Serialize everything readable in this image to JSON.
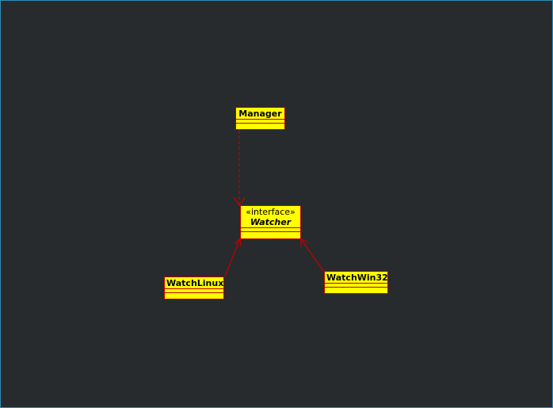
{
  "diagram": {
    "type": "uml-class-diagram",
    "colors": {
      "background": "#272b2e",
      "class_fill": "#ffff00",
      "class_border": "#c00000",
      "edge": "#c00000",
      "frame_border": "#2f8fb8"
    },
    "classes": {
      "manager": {
        "name": "Manager"
      },
      "watcher": {
        "stereotype": "«interface»",
        "name": "Watcher"
      },
      "watch_linux": {
        "name": "WatchLinux"
      },
      "watch_win32": {
        "name": "WatchWin32"
      }
    },
    "relations": [
      {
        "from": "Manager",
        "to": "Watcher",
        "kind": "dependency"
      },
      {
        "from": "WatchLinux",
        "to": "Watcher",
        "kind": "realization"
      },
      {
        "from": "WatchWin32",
        "to": "Watcher",
        "kind": "realization"
      }
    ]
  }
}
